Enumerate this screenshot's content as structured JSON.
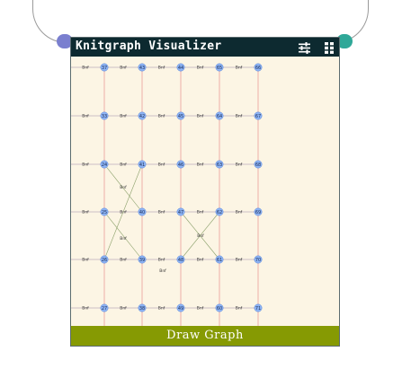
{
  "window": {
    "title": "Knitgraph Visualizer",
    "settings_icon": "sliders-icon",
    "grid_icon": "grid-icon"
  },
  "colors": {
    "title_bg": "#0d2a30",
    "graph_bg": "#fcf5e4",
    "button_bg": "#869a03",
    "port_left": "#7a7fcf",
    "port_right": "#2fa898",
    "node_fill": "#8db4f5",
    "node_stroke": "#5a85d8",
    "course_edge": "#9a8aa8",
    "wale_edge": "#e89090"
  },
  "graph": {
    "columns": [
      {
        "key": "c0",
        "nodes": [
          "37",
          "33",
          "24",
          "25",
          "26",
          "27"
        ]
      },
      {
        "key": "c1",
        "nodes": [
          "43",
          "42",
          "41",
          "40",
          "39",
          "38"
        ]
      },
      {
        "key": "c2",
        "nodes": [
          "44",
          "45",
          "46",
          "47",
          "48",
          "49"
        ]
      },
      {
        "key": "c3",
        "nodes": [
          "65",
          "64",
          "63",
          "62",
          "61",
          "60"
        ]
      },
      {
        "key": "c4",
        "nodes": [
          "66",
          "67",
          "68",
          "69",
          "70",
          "71"
        ]
      }
    ],
    "edge_labels": [
      [
        "Bnf",
        "Bnf",
        "Bnf",
        "Bnf",
        "Bnf",
        "Bnf"
      ],
      [
        "Bnf",
        "Bnf",
        "Bnf",
        "Bnf",
        "Bnf",
        "Bnf"
      ],
      [
        "Bnf",
        "Bnf",
        "Bnf",
        "Bnf",
        "Bnf",
        "Bnf"
      ],
      [
        "Bnf",
        "Bnf",
        "Bnf",
        "Bnf",
        "Bnf",
        "Bnf"
      ],
      [
        "Bnf",
        "Bnf",
        "Bnf",
        "Bnf",
        "Bnf",
        "Bnf"
      ]
    ],
    "cable_labels": [
      "Bnf",
      "Bnf",
      "Bnf",
      "Bnf"
    ]
  },
  "draw_button": {
    "label": "Draw Graph"
  }
}
